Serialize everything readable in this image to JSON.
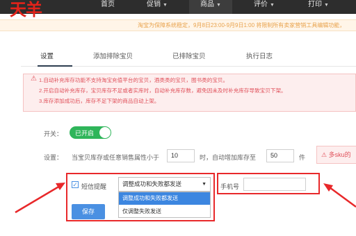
{
  "logo": "天羊",
  "nav": [
    {
      "label": "首页",
      "has_caret": false
    },
    {
      "label": "促销",
      "has_caret": true
    },
    {
      "label": "商品",
      "has_caret": true
    },
    {
      "label": "评价",
      "has_caret": true
    },
    {
      "label": "打印",
      "has_caret": true
    }
  ],
  "notice": "淘宝为保障系统稳定，9月8日23:00-9月9日1:00 将限制所有卖家营销工具编辑功能，",
  "tabs": [
    "设置",
    "添加排除宝贝",
    "已排除宝贝",
    "执行日志"
  ],
  "warning": {
    "lines": [
      "1.自动补充库存功能不支持淘宝充值平台的宝贝，酒类类的宝贝，图书类的宝贝。",
      "2.开启自动补充库存，宝贝库存不足或者实库时，自动补充库存数，避免因未及时补充库存导致宝贝下架。",
      "3.库存添加成功后，库存不足下架的商品自动上架。"
    ]
  },
  "switch": {
    "label": "开关：",
    "value": "已开启"
  },
  "settings": {
    "label": "设置：",
    "text_before": "当宝贝库存或任意销售属性小于",
    "threshold": "10",
    "text_middle": "时，自动增加库存至",
    "target": "50",
    "unit": "件",
    "hint": "多sku的"
  },
  "sms": {
    "checkbox_label": "短信提醒",
    "checked": true,
    "select_value": "调整成功和失败都发送",
    "options": [
      "调整成功和失败都发送",
      "仅调整失败发送"
    ],
    "phone_placeholder": "手机号"
  },
  "save_label": "保存",
  "colors": {
    "accent": "#2fb55a",
    "highlight": "#e8282a",
    "brand": "#e2231a",
    "primary": "#4a90e2"
  }
}
